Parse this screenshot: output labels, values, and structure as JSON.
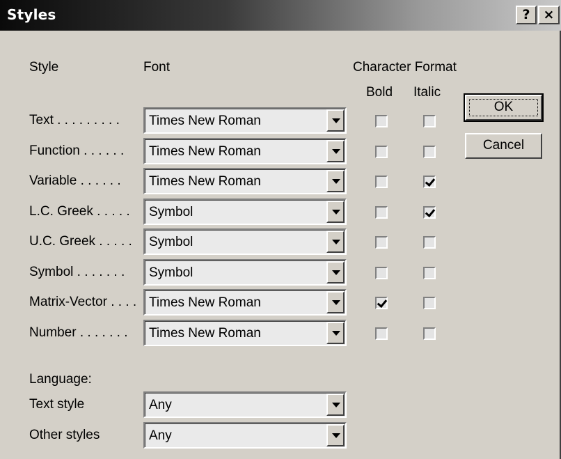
{
  "window": {
    "title": "Styles",
    "help_label": "?",
    "close_label": "×"
  },
  "headers": {
    "style": "Style",
    "font": "Font",
    "character_format": "Character Format",
    "bold": "Bold",
    "italic": "Italic"
  },
  "styles": [
    {
      "label": "Text . . . . . . . . .",
      "font": "Times New Roman",
      "bold": false,
      "italic": false
    },
    {
      "label": "Function . . . . . .",
      "font": "Times New Roman",
      "bold": false,
      "italic": false
    },
    {
      "label": "Variable . . . . . .",
      "font": "Times New Roman",
      "bold": false,
      "italic": true
    },
    {
      "label": "L.C. Greek . . . . .",
      "font": "Symbol",
      "bold": false,
      "italic": true
    },
    {
      "label": "U.C. Greek . . . . .",
      "font": "Symbol",
      "bold": false,
      "italic": false
    },
    {
      "label": "Symbol . . . . . . .",
      "font": "Symbol",
      "bold": false,
      "italic": false
    },
    {
      "label": "Matrix-Vector . . . .",
      "font": "Times New Roman",
      "bold": true,
      "italic": false
    },
    {
      "label": "Number . . . . . . .",
      "font": "Times New Roman",
      "bold": false,
      "italic": false
    }
  ],
  "language": {
    "heading": "Language:",
    "text_style_label": "Text style",
    "text_style_value": "Any",
    "other_styles_label": "Other styles",
    "other_styles_value": "Any"
  },
  "buttons": {
    "ok": "OK",
    "cancel": "Cancel"
  }
}
